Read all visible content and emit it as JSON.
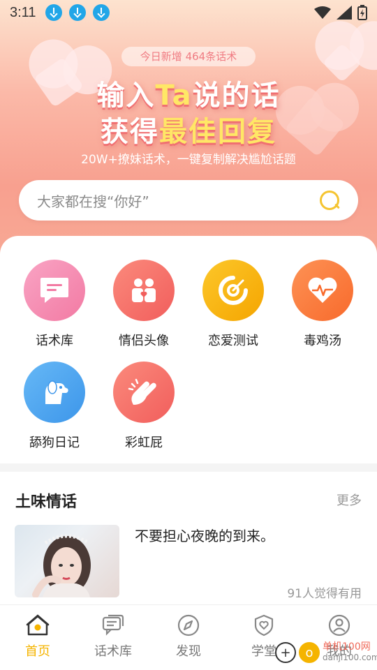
{
  "status_bar": {
    "time": "3:11"
  },
  "banner": {
    "badge": "今日新增 464条话术",
    "line1_a": "输入",
    "line1_hl": "Ta",
    "line1_b": "说的话",
    "line2_a": "获得",
    "line2_hl": "最佳回复",
    "subtitle": "20W+撩妹话术，一键复制解决尴尬话题"
  },
  "search": {
    "placeholder": "大家都在搜“你好”"
  },
  "features": [
    {
      "label": "话术库",
      "color": "#f58fb2",
      "icon": "chat-bubble-icon"
    },
    {
      "label": "情侣头像",
      "color": "#f86f66",
      "icon": "couple-icon"
    },
    {
      "label": "恋爱测试",
      "color": "#f8b500",
      "icon": "target-icon"
    },
    {
      "label": "毒鸡汤",
      "color": "#fb7d3f",
      "icon": "heartbeat-icon"
    },
    {
      "label": "舔狗日记",
      "color": "#4aa7f0",
      "icon": "dog-icon"
    },
    {
      "label": "彩虹屁",
      "color": "#f9716a",
      "icon": "clap-icon"
    }
  ],
  "section": {
    "title": "土味情话",
    "more": "更多",
    "item": {
      "text": "不要担心夜晚的到来。",
      "useful": "91人觉得有用"
    }
  },
  "tabs": [
    {
      "label": "首页",
      "icon": "home-icon",
      "active": true
    },
    {
      "label": "话术库",
      "icon": "chat-icon",
      "active": false
    },
    {
      "label": "发现",
      "icon": "compass-icon",
      "active": false
    },
    {
      "label": "学堂",
      "icon": "shield-icon",
      "active": false
    },
    {
      "label": "我的",
      "icon": "user-icon",
      "active": false
    }
  ],
  "watermark": {
    "name": "单机100网",
    "url": "danji100.com"
  },
  "colors": {
    "accent": "#f5b400",
    "hero_pink": "#f8a08f"
  }
}
